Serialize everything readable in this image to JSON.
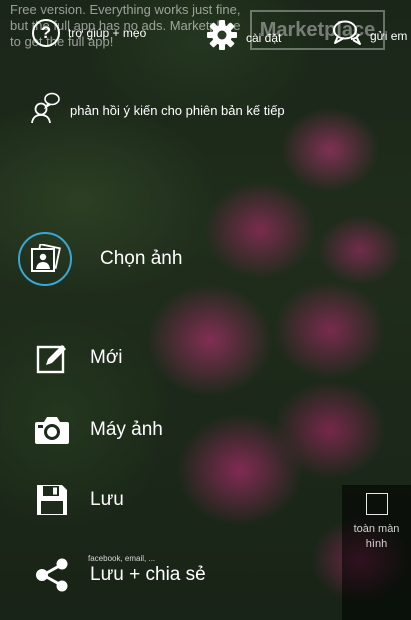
{
  "banner": {
    "text": "Free version. Everything works just fine, but the full app has no ads. Marketplace to get the full app!",
    "marketplace_label": "Marketplace"
  },
  "toolbar": {
    "help_label": "trợ giúp + mẹo",
    "help_glyph": "?",
    "settings_label": "cài đặt",
    "email_label": "gửi em"
  },
  "feedback": {
    "label": "phản hồi ý kiến cho phiên bản kế tiếp"
  },
  "menu": {
    "choose_photo": "Chọn ảnh",
    "new": "Mới",
    "camera": "Máy ảnh",
    "save": "Lưu",
    "save_share": "Lưu + chia sẻ",
    "save_share_sub": "facebook, email, ..."
  },
  "fullscreen": {
    "label": "toàn màn hình"
  },
  "colors": {
    "accent": "#39a7d6",
    "text": "#ffffff"
  },
  "icons": {
    "help": "question-circle-icon",
    "settings": "gear-icon",
    "email": "speech-bubble-icon",
    "feedback": "person-speech-icon",
    "choose": "photos-icon",
    "new": "edit-icon",
    "camera": "camera-icon",
    "save": "floppy-icon",
    "share": "share-icon",
    "fullscreen": "square-icon"
  }
}
